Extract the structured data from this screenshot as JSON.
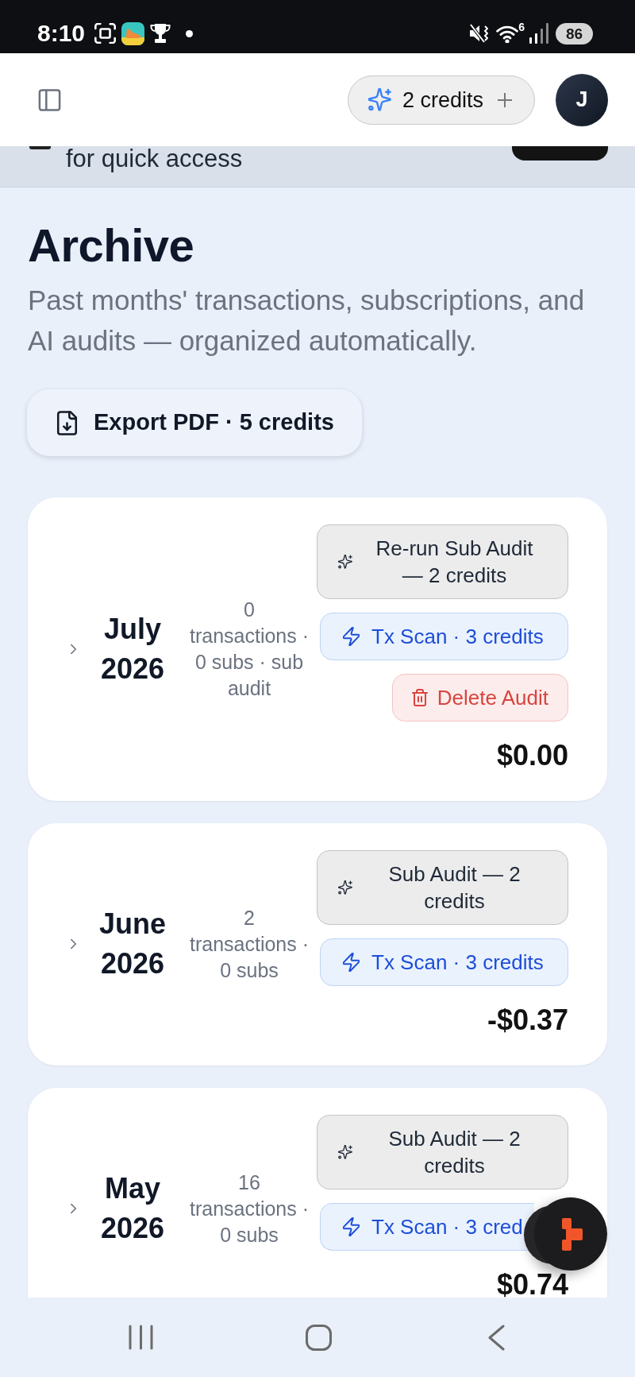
{
  "status_bar": {
    "time": "8:10",
    "network_label": "6",
    "battery": "86"
  },
  "header": {
    "credits": "2 credits",
    "avatar_initial": "J"
  },
  "banner": {
    "text": "for quick access"
  },
  "archive": {
    "title": "Archive",
    "subtitle": "Past months' transactions, subscriptions, and AI audits — organized automatically.",
    "export_button": "Export PDF · 5 credits"
  },
  "months": [
    {
      "month": "July 2026",
      "expanded": false,
      "summary": "0 transactions · 0 subs · sub audit",
      "actions": [
        {
          "kind": "audit",
          "label": "Re-run Sub Audit — 2 credits"
        },
        {
          "kind": "scan",
          "label": "Tx Scan · 3 credits"
        },
        {
          "kind": "delete",
          "label": "Delete Audit"
        }
      ],
      "total": "$0.00"
    },
    {
      "month": "June 2026",
      "expanded": false,
      "summary": "2 transactions · 0 subs",
      "actions": [
        {
          "kind": "audit",
          "label": "Sub Audit — 2 credits"
        },
        {
          "kind": "scan",
          "label": "Tx Scan · 3 credits"
        }
      ],
      "total": "-$0.37"
    },
    {
      "month": "May 2026",
      "expanded": false,
      "summary": "16 transactions · 0 subs",
      "actions": [
        {
          "kind": "audit",
          "label": "Sub Audit — 2 credits"
        },
        {
          "kind": "scan",
          "label": "Tx Scan · 3 cred"
        }
      ],
      "total": "$0.74"
    }
  ]
}
